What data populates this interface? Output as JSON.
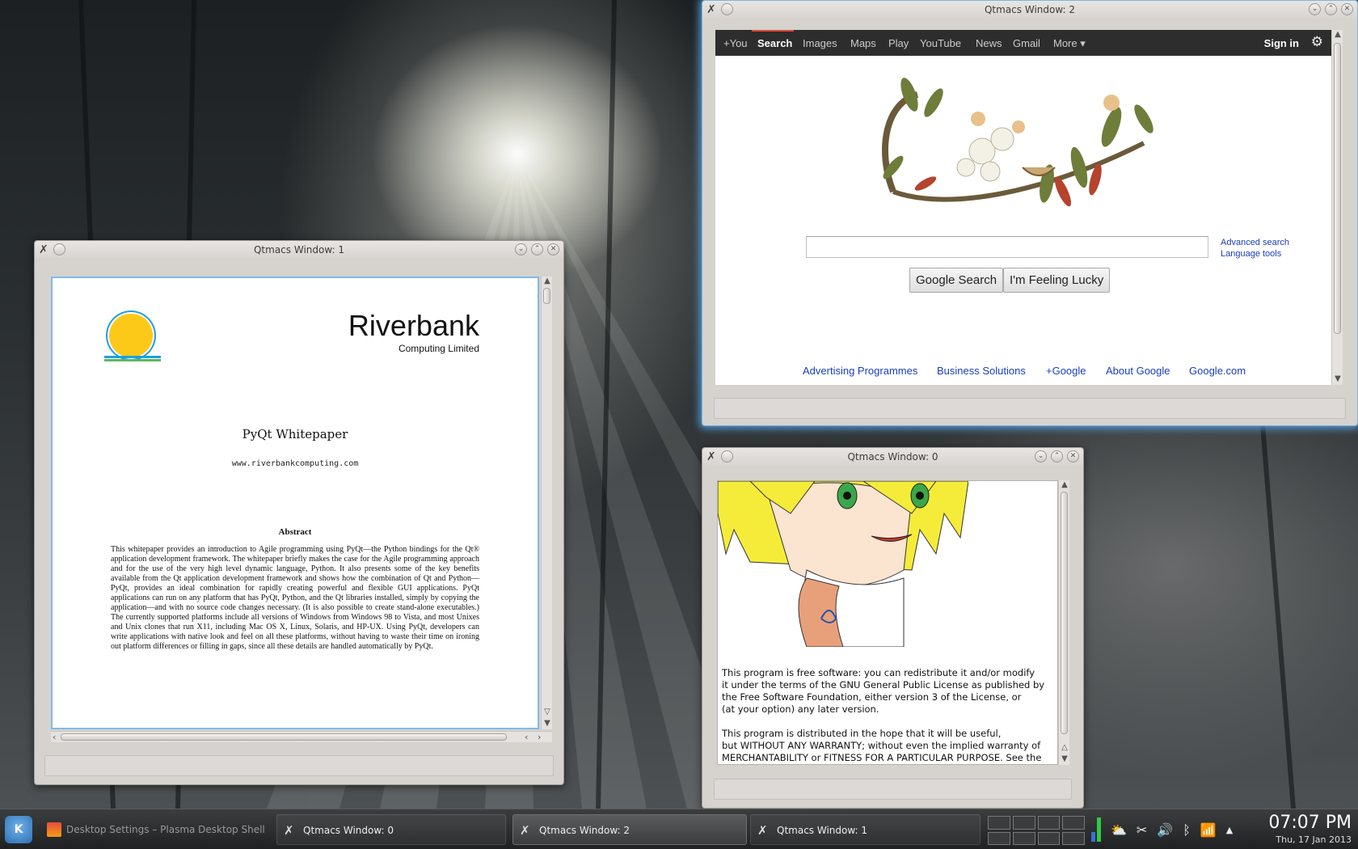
{
  "colors": {
    "accent": "#7fbbe8",
    "link": "#1a3dc1",
    "google_bar": "#2d2d2d",
    "taskbar": "#2a2c2e"
  },
  "window1": {
    "title": "Qtmacs Window: 1",
    "doc": {
      "company": "Riverbank",
      "company_sub": "Computing Limited",
      "title": "PyQt Whitepaper",
      "url": "www.riverbankcomputing.com",
      "abstract_heading": "Abstract",
      "abstract_text": "This whitepaper provides an introduction to Agile programming using PyQt—the Python bindings for the Qt® application development framework. The whitepaper briefly makes the case for the Agile programming approach and for the use of the very high level dynamic language, Python. It also presents some of the key benefits available from the Qt application development framework and shows how the combination of Qt and Python—PyQt, provides an ideal combination for rapidly creating powerful and flexible GUI applications. PyQt applications can run on any platform that has PyQt, Python, and the Qt libraries installed, simply by copying the application—and with no source code changes necessary. (It is also possible to create stand-alone executables.) The currently supported platforms include all versions of Windows from Windows 98 to Vista, and most Unixes and Unix clones that run X11, including Mac OS X, Linux, Solaris, and HP-UX. Using PyQt, developers can write applications with native look and feel on all these platforms, without having to waste their time on ironing out platform differences or filling in gaps, since all these details are handled automatically by PyQt."
    }
  },
  "window2": {
    "title": "Qtmacs Window: 2",
    "nav": [
      "+You",
      "Search",
      "Images",
      "Maps",
      "Play",
      "YouTube",
      "News",
      "Gmail",
      "More ▾"
    ],
    "signin": "Sign in",
    "search_value": "",
    "advanced_search": "Advanced search",
    "language_tools": "Language tools",
    "btn_search": "Google Search",
    "btn_lucky": "I'm Feeling Lucky",
    "footer": [
      "Advertising Programmes",
      "Business Solutions",
      "+Google",
      "About Google",
      "Google.com"
    ]
  },
  "window0": {
    "title": "Qtmacs Window: 0",
    "license_lines": [
      "This program is free software: you can redistribute it and/or modify",
      "it under the terms of the GNU General Public License as published by",
      "the Free Software Foundation, either version 3 of the License, or",
      "(at your option) any later version.",
      "",
      "This program is distributed in the hope that it will be useful,",
      "but WITHOUT ANY WARRANTY; without even the implied warranty of",
      "MERCHANTABILITY or FITNESS FOR A PARTICULAR PURPOSE.  See the"
    ]
  },
  "taskbar": {
    "tasks": [
      {
        "label": "Desktop Settings – Plasma Desktop Shell",
        "state": "dim"
      },
      {
        "label": "Qtmacs Window: 0",
        "state": "normal"
      },
      {
        "label": "Qtmacs Window: 2",
        "state": "active"
      },
      {
        "label": "Qtmacs Window: 1",
        "state": "normal"
      }
    ],
    "time": "07:07 PM",
    "date": "Thu, 17 Jan 2013"
  }
}
